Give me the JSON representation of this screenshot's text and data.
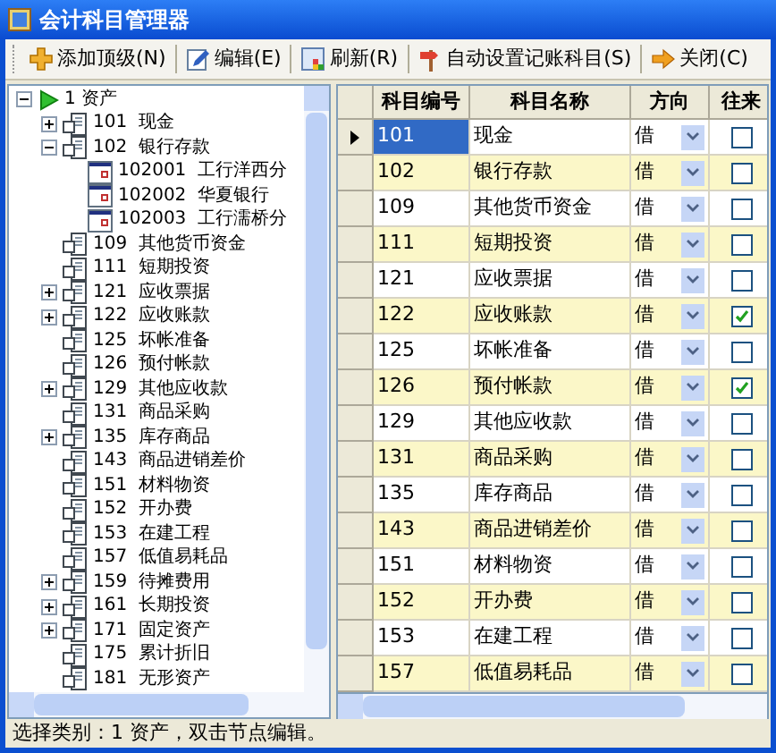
{
  "window": {
    "title": "会计科目管理器"
  },
  "toolbar": [
    {
      "label": "添加顶级(N)",
      "kind": "add"
    },
    {
      "label": "编辑(E)",
      "kind": "edit"
    },
    {
      "label": "刷新(R)",
      "kind": "refresh"
    },
    {
      "label": "自动设置记账科目(S)",
      "kind": "auto"
    },
    {
      "label": "关闭(C)",
      "kind": "close"
    }
  ],
  "tree": {
    "root": {
      "label": "1 资产",
      "expandable": true,
      "expanded": true,
      "children": [
        {
          "code": "101",
          "name": "现金",
          "expandable": true,
          "expanded": false,
          "kind": "account"
        },
        {
          "code": "102",
          "name": "银行存款",
          "expandable": true,
          "expanded": true,
          "kind": "account",
          "children": [
            {
              "code": "102001",
              "name": "工行洋西分",
              "expandable": false,
              "kind": "sub"
            },
            {
              "code": "102002",
              "name": "华夏银行",
              "expandable": false,
              "kind": "sub"
            },
            {
              "code": "102003",
              "name": "工行濡桥分",
              "expandable": false,
              "kind": "sub"
            }
          ]
        },
        {
          "code": "109",
          "name": "其他货币资金",
          "expandable": false,
          "kind": "account"
        },
        {
          "code": "111",
          "name": "短期投资",
          "expandable": false,
          "kind": "account"
        },
        {
          "code": "121",
          "name": "应收票据",
          "expandable": true,
          "expanded": false,
          "kind": "account"
        },
        {
          "code": "122",
          "name": "应收账款",
          "expandable": true,
          "expanded": false,
          "kind": "account"
        },
        {
          "code": "125",
          "name": "坏帐准备",
          "expandable": false,
          "kind": "account"
        },
        {
          "code": "126",
          "name": "预付帐款",
          "expandable": false,
          "kind": "account"
        },
        {
          "code": "129",
          "name": "其他应收款",
          "expandable": true,
          "expanded": false,
          "kind": "account"
        },
        {
          "code": "131",
          "name": "商品采购",
          "expandable": false,
          "kind": "account"
        },
        {
          "code": "135",
          "name": "库存商品",
          "expandable": true,
          "expanded": false,
          "kind": "account"
        },
        {
          "code": "143",
          "name": "商品进销差价",
          "expandable": false,
          "kind": "account"
        },
        {
          "code": "151",
          "name": "材料物资",
          "expandable": false,
          "kind": "account"
        },
        {
          "code": "152",
          "name": "开办费",
          "expandable": false,
          "kind": "account"
        },
        {
          "code": "153",
          "name": "在建工程",
          "expandable": false,
          "kind": "account"
        },
        {
          "code": "157",
          "name": "低值易耗品",
          "expandable": false,
          "kind": "account"
        },
        {
          "code": "159",
          "name": "待摊费用",
          "expandable": true,
          "expanded": false,
          "kind": "account"
        },
        {
          "code": "161",
          "name": "长期投资",
          "expandable": true,
          "expanded": false,
          "kind": "account"
        },
        {
          "code": "171",
          "name": "固定资产",
          "expandable": true,
          "expanded": false,
          "kind": "account"
        },
        {
          "code": "175",
          "name": "累计折旧",
          "expandable": false,
          "kind": "account"
        },
        {
          "code": "181",
          "name": "无形资产",
          "expandable": false,
          "kind": "account"
        }
      ]
    }
  },
  "table": {
    "columns": [
      "科目编号",
      "科目名称",
      "方向",
      "往来"
    ],
    "rows": [
      {
        "code": "101",
        "name": "现金",
        "direction": "借",
        "checked": false,
        "selected": true
      },
      {
        "code": "102",
        "name": "银行存款",
        "direction": "借",
        "checked": false,
        "selected": false
      },
      {
        "code": "109",
        "name": "其他货币资金",
        "direction": "借",
        "checked": false,
        "selected": false
      },
      {
        "code": "111",
        "name": "短期投资",
        "direction": "借",
        "checked": false,
        "selected": false
      },
      {
        "code": "121",
        "name": "应收票据",
        "direction": "借",
        "checked": false,
        "selected": false
      },
      {
        "code": "122",
        "name": "应收账款",
        "direction": "借",
        "checked": true,
        "selected": false
      },
      {
        "code": "125",
        "name": "坏帐准备",
        "direction": "借",
        "checked": false,
        "selected": false
      },
      {
        "code": "126",
        "name": "预付帐款",
        "direction": "借",
        "checked": true,
        "selected": false
      },
      {
        "code": "129",
        "name": "其他应收款",
        "direction": "借",
        "checked": false,
        "selected": false
      },
      {
        "code": "131",
        "name": "商品采购",
        "direction": "借",
        "checked": false,
        "selected": false
      },
      {
        "code": "135",
        "name": "库存商品",
        "direction": "借",
        "checked": false,
        "selected": false
      },
      {
        "code": "143",
        "name": "商品进销差价",
        "direction": "借",
        "checked": false,
        "selected": false
      },
      {
        "code": "151",
        "name": "材料物资",
        "direction": "借",
        "checked": false,
        "selected": false
      },
      {
        "code": "152",
        "name": "开办费",
        "direction": "借",
        "checked": false,
        "selected": false
      },
      {
        "code": "153",
        "name": "在建工程",
        "direction": "借",
        "checked": false,
        "selected": false
      },
      {
        "code": "157",
        "name": "低值易耗品",
        "direction": "借",
        "checked": false,
        "selected": false
      }
    ]
  },
  "status_bar": "选择类别：1 资产，双击节点编辑。"
}
